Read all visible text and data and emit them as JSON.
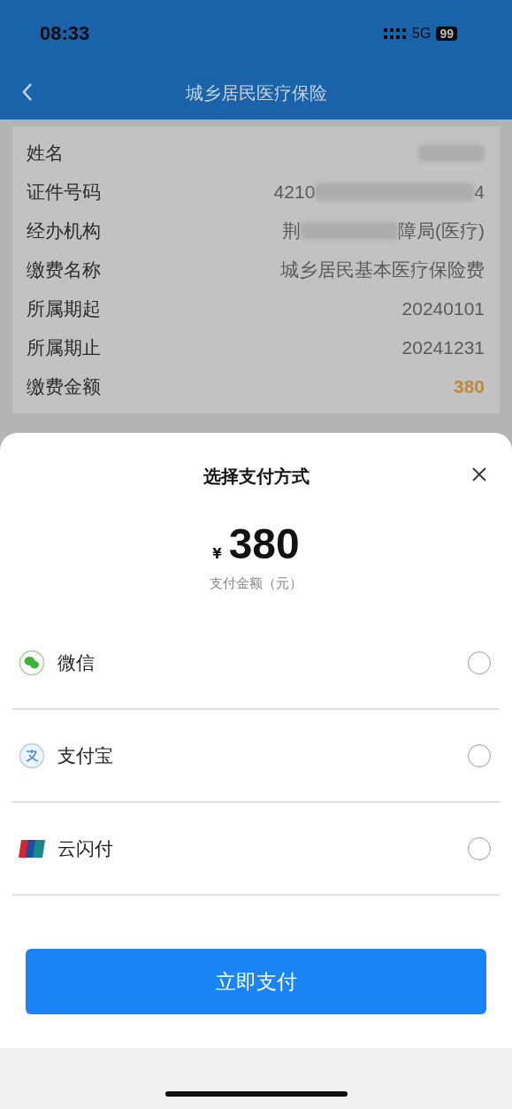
{
  "status_bar": {
    "time": "08:33",
    "network": "5G",
    "battery": "99"
  },
  "nav": {
    "title": "城乡居民医疗保险"
  },
  "info_rows": [
    {
      "label": "姓名",
      "value": [
        {
          "kind": "blur"
        }
      ]
    },
    {
      "label": "证件号码",
      "value": [
        {
          "kind": "text",
          "text": "4210"
        },
        {
          "kind": "blur"
        },
        {
          "kind": "text",
          "text": "4"
        }
      ]
    },
    {
      "label": "经办机构",
      "value": [
        {
          "kind": "text",
          "text": "荆"
        },
        {
          "kind": "blur"
        },
        {
          "kind": "text",
          "text": "障局(医疗)"
        }
      ]
    },
    {
      "label": "缴费名称",
      "value": [
        {
          "kind": "text",
          "text": "城乡居民基本医疗保险费"
        }
      ]
    },
    {
      "label": "所属期起",
      "value": [
        {
          "kind": "text",
          "text": "20240101"
        }
      ]
    },
    {
      "label": "所属期止",
      "value": [
        {
          "kind": "text",
          "text": "20241231"
        }
      ]
    },
    {
      "label": "缴费金额",
      "value": [
        {
          "kind": "amount",
          "text": "380"
        }
      ]
    }
  ],
  "sheet": {
    "title": "选择支付方式",
    "currency": "¥",
    "amount": "380",
    "amount_caption": "支付金额（元）",
    "methods": [
      {
        "kind": "wechat",
        "label": "微信",
        "selected": false
      },
      {
        "kind": "alipay",
        "label": "支付宝",
        "selected": false
      },
      {
        "kind": "unionpay",
        "label": "云闪付",
        "selected": false
      }
    ],
    "pay_button": "立即支付"
  }
}
